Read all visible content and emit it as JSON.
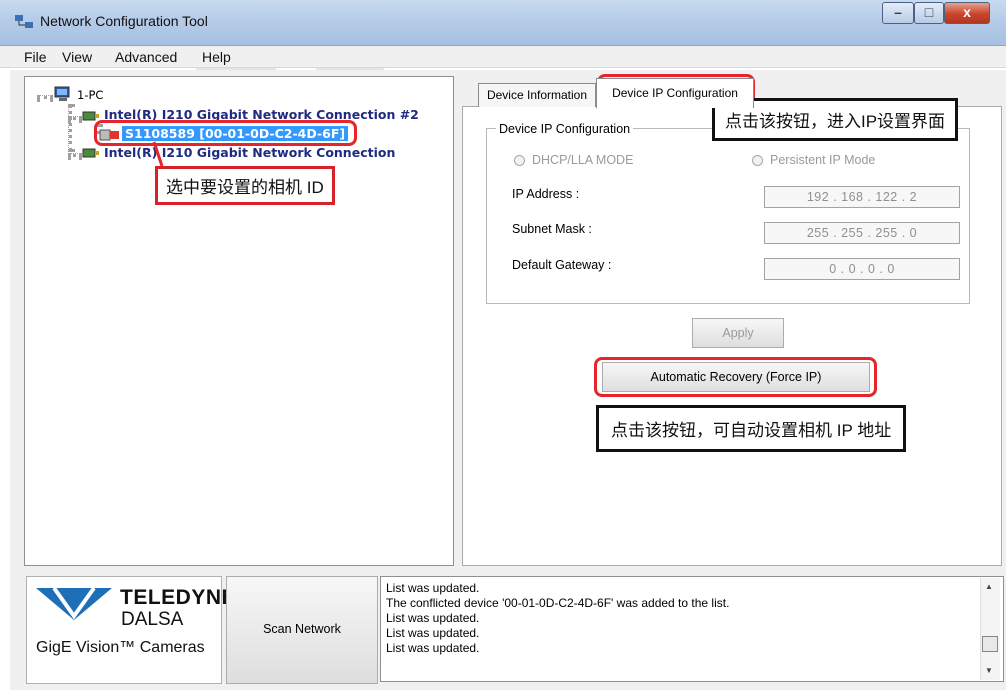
{
  "window": {
    "title": "Network Configuration Tool",
    "min_glyph": "–",
    "max_glyph": "□",
    "close_glyph": "x"
  },
  "menu": [
    "File",
    "View",
    "Advanced",
    "Help"
  ],
  "tree": {
    "root": "1-PC",
    "nic1": "Intel(R) I210 Gigabit Network Connection #2",
    "device": "S1108589 [00-01-0D-C2-4D-6F]",
    "nic2": "Intel(R) I210 Gigabit Network Connection"
  },
  "tabs": {
    "device_info": "Device Information",
    "device_ip": "Device IP Configuration"
  },
  "ip_config": {
    "group_title": "Device IP Configuration",
    "dhcp_label": "DHCP/LLA MODE",
    "persistent_label": "Persistent IP Mode",
    "ip_label": "IP Address :",
    "ip_value": "192 . 168 . 122 . 2",
    "subnet_label": "Subnet Mask :",
    "subnet_value": "255 . 255 . 255 . 0",
    "gateway_label": "Default Gateway :",
    "gateway_value": "0 . 0 . 0 . 0",
    "apply_label": "Apply",
    "force_ip_label": "Automatic Recovery (Force IP)"
  },
  "logo": {
    "brand_line1": "TELEDYNE",
    "brand_line2": "DALSA",
    "tagline": "GigE Vision™ Cameras"
  },
  "scan_button": "Scan Network",
  "log": [
    "List was updated.",
    "The conflicted device '00-01-0D-C2-4D-6F' was added to the list.",
    "List was updated.",
    "List was updated.",
    "List was updated."
  ],
  "annotations": {
    "select_camera": "选中要设置的相机 ID",
    "enter_ip_settings": "点击该按钮，进入IP设置界面",
    "auto_set_ip": "点击该按钮，可自动设置相机 IP 地址"
  },
  "colors": {
    "accent_red": "#e5242c",
    "nic_text": "#1f2a80",
    "selection": "#3399ff",
    "logo_blue": "#1d6fb8"
  }
}
